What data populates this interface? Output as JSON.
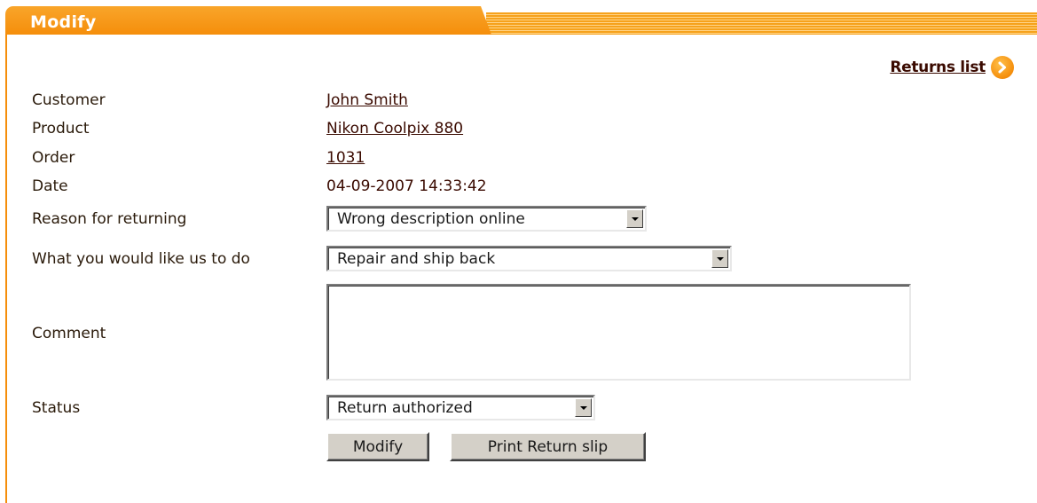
{
  "header": {
    "title": "Modify"
  },
  "nav": {
    "returns_list_label": "Returns list"
  },
  "form": {
    "customer": {
      "label": "Customer",
      "value": "John Smith"
    },
    "product": {
      "label": "Product",
      "value": "Nikon Coolpix 880"
    },
    "order": {
      "label": "Order",
      "value": "1031"
    },
    "date": {
      "label": "Date",
      "value": "04-09-2007 14:33:42"
    },
    "reason": {
      "label": "Reason for returning",
      "selected": "Wrong description online"
    },
    "action": {
      "label": "What you would like us to do",
      "selected": "Repair and ship back"
    },
    "comment": {
      "label": "Comment",
      "value": ""
    },
    "status": {
      "label": "Status",
      "selected": "Return authorized"
    }
  },
  "buttons": {
    "modify_label": "Modify",
    "print_label": "Print Return slip"
  },
  "colors": {
    "accent": "#f58e0b",
    "text": "#3a0a00"
  }
}
